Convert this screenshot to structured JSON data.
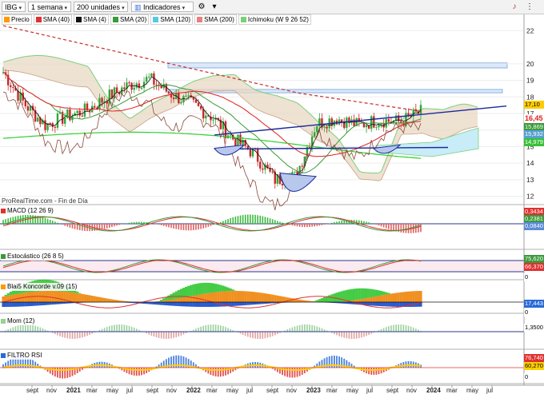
{
  "toolbar": {
    "symbol": "IBG",
    "period": "1 semana",
    "units": "200 unidades",
    "indicators": "Indicadores"
  },
  "legend": [
    {
      "label": "Precio",
      "color": "#ff9900"
    },
    {
      "label": "SMA (40)",
      "color": "#e03030"
    },
    {
      "label": "SMA (4)",
      "color": "#111111"
    },
    {
      "label": "SMA (20)",
      "color": "#3a9a3a"
    },
    {
      "label": "SMA (120)",
      "color": "#58c8e0"
    },
    {
      "label": "SMA (200)",
      "color": "#e88080"
    },
    {
      "label": "Ichimoku (W 9 26 52)",
      "color": "#7ad07a"
    }
  ],
  "source_text": "ProRealTime.com - Fin de Día",
  "price_axis": {
    "ticks": [
      "22",
      "20",
      "19",
      "18",
      "17",
      "16",
      "15",
      "14",
      "13",
      "12"
    ]
  },
  "price_values": {
    "v1": "17,10",
    "v2": "16,45",
    "v3": "15,869",
    "v4": "15,932",
    "v5": "14,979"
  },
  "panels": [
    {
      "label": "MACD (12 26 9)",
      "values": [
        "0,3434",
        "0,2381",
        "0,0840"
      ],
      "zero": "0",
      "colors": [
        "#e03030",
        "#3a9a3a",
        "#5a8ad8"
      ]
    },
    {
      "label": "Estocástico (26 8 5)",
      "values": [
        "75,620",
        "66,370"
      ],
      "zero": "0",
      "colors": [
        "#3a9a3a",
        "#e03030"
      ]
    },
    {
      "label": "Blai5 Koncorde v.09 (15)",
      "values": [
        "17,443"
      ],
      "zero": "0",
      "colors": [
        "#ff9900",
        "#2a6ad8",
        "#18c018"
      ]
    },
    {
      "label": "Mom (12)",
      "values": [
        "1,3500"
      ],
      "zero": "0",
      "colors": [
        "#9ad09a"
      ]
    },
    {
      "label": "FILTRO RSI",
      "values": [
        "76,740",
        "60,270"
      ],
      "zero": "0",
      "colors": [
        "#e03030",
        "#2a6ad8",
        "#ffd000"
      ]
    }
  ],
  "time_axis": [
    "sept",
    "nov",
    "2021",
    "mar",
    "may",
    "jul",
    "sept",
    "nov",
    "2022",
    "mar",
    "may",
    "jul",
    "sept",
    "nov",
    "2023",
    "mar",
    "may",
    "jul",
    "sept",
    "nov",
    "2024",
    "mar",
    "may",
    "jul"
  ],
  "chart_data": {
    "type": "candlestick",
    "x": [
      "2020-08",
      "2020-10",
      "2020-12",
      "2021-02",
      "2021-04",
      "2021-06",
      "2021-08",
      "2021-10",
      "2021-12",
      "2022-02",
      "2022-04",
      "2022-06",
      "2022-08",
      "2022-10",
      "2022-12",
      "2023-02",
      "2023-04",
      "2023-06",
      "2023-08",
      "2023-10",
      "2023-11"
    ],
    "series": [
      {
        "values": [
          19.5,
          17.6,
          16.3,
          16.8,
          17.2,
          18.0,
          18.7,
          19.1,
          18.2,
          17.6,
          16.8,
          15.5,
          14.6,
          13.0,
          13.2,
          16.4,
          16.7,
          16.3,
          16.6,
          16.5,
          17.1
        ]
      }
    ],
    "ylim": [
      11.5,
      22.5
    ]
  }
}
